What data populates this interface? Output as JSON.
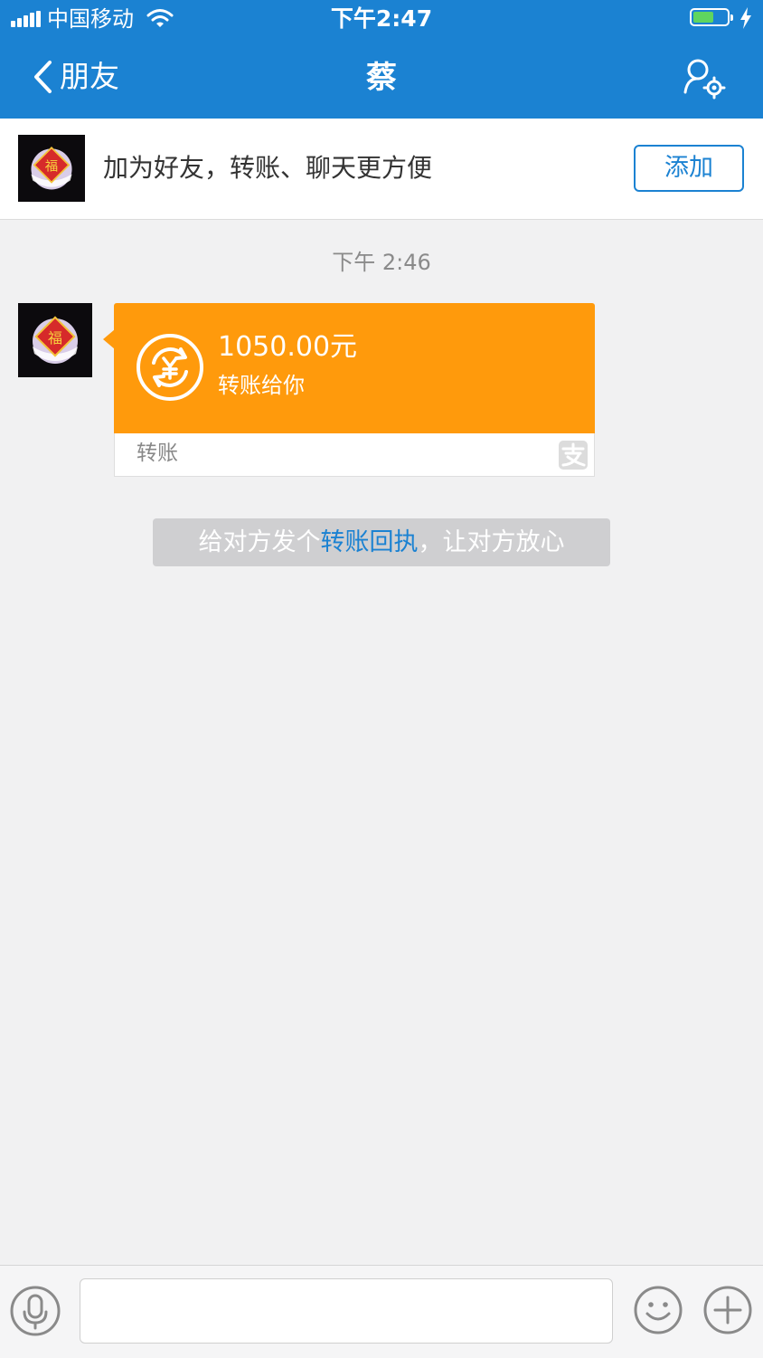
{
  "status_bar": {
    "carrier": "中国移动",
    "time": "下午2:47",
    "battery_level": 0.62
  },
  "nav": {
    "back_label": "朋友",
    "title": "蔡",
    "right_icon": "profile-settings-icon"
  },
  "add_friend_banner": {
    "avatar_text": "福",
    "text": "加为好友，转账、聊天更方便",
    "button_label": "添加"
  },
  "chat": {
    "timestamp": "下午 2:46",
    "messages": [
      {
        "type": "transfer",
        "sender_avatar_text": "福",
        "icon": "yuan-transfer-icon",
        "amount": "1050.00元",
        "subtitle": "转账给你",
        "footer_label": "转账",
        "footer_icon": "alipay-icon"
      }
    ],
    "receipt_tip": {
      "prefix": "给对方发个",
      "link": "转账回执",
      "suffix": "，让对方放心"
    }
  },
  "input_bar": {
    "voice_icon": "microphone-icon",
    "placeholder": "",
    "emoji_icon": "smiley-icon",
    "more_icon": "plus-icon"
  },
  "colors": {
    "header_blue": "#1b82d2",
    "transfer_orange": "#ff9a0c",
    "background": "#f1f1f2"
  }
}
